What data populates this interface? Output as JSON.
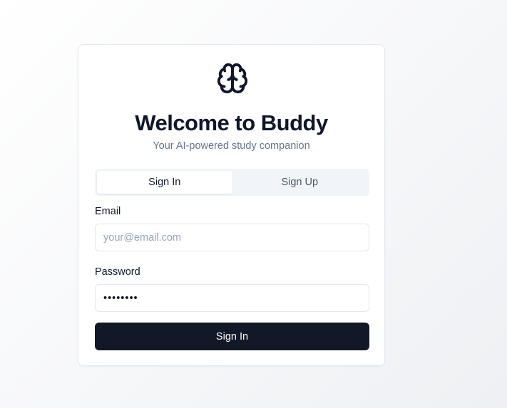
{
  "app": {
    "logo_icon": "brain-icon",
    "title": "Welcome to Buddy",
    "subtitle": "Your AI-powered study companion"
  },
  "tabs": [
    {
      "label": "Sign In",
      "active": true
    },
    {
      "label": "Sign Up",
      "active": false
    }
  ],
  "form": {
    "email": {
      "label": "Email",
      "placeholder": "your@email.com",
      "value": ""
    },
    "password": {
      "label": "Password",
      "value": "••••••••"
    },
    "submit_label": "Sign In"
  },
  "colors": {
    "primary": "#111827",
    "muted_text": "#64748b",
    "tab_track": "#f1f5f9",
    "border": "#e2e8f0"
  }
}
